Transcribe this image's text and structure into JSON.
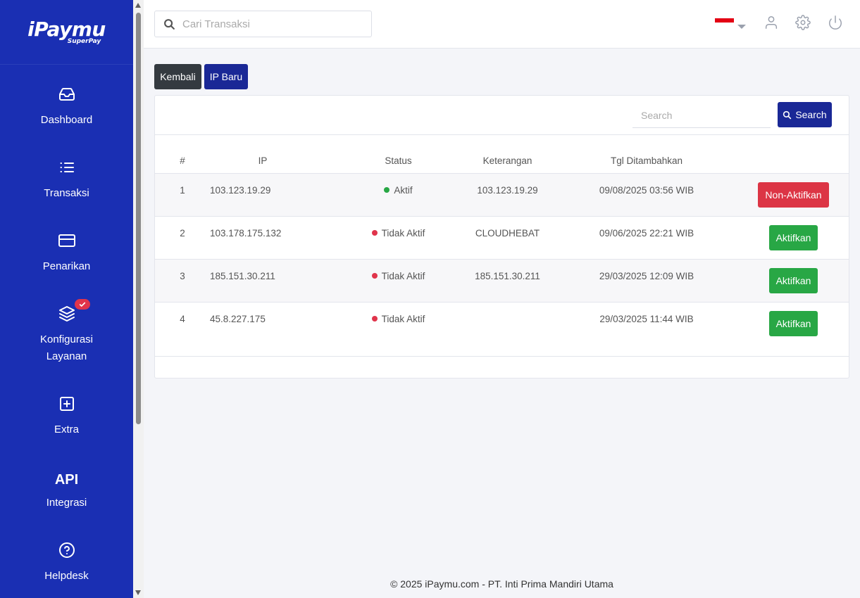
{
  "brand": {
    "name": "iPaymu",
    "sub": "SuperPay"
  },
  "sidebar": {
    "items": [
      {
        "label": "Dashboard",
        "icon": "inbox-icon"
      },
      {
        "label": "Transaksi",
        "icon": "list-icon"
      },
      {
        "label": "Penarikan",
        "icon": "credit-card-icon"
      },
      {
        "label": "Konfigurasi Layanan",
        "icon": "layers-icon",
        "badge": "check-icon"
      },
      {
        "label": "Extra",
        "icon": "plus-square-icon"
      },
      {
        "label": "Integrasi",
        "icon_text": "API"
      },
      {
        "label": "Helpdesk",
        "icon": "help-circle-icon"
      }
    ]
  },
  "header": {
    "search_placeholder": "Cari Transaksi",
    "language": "id",
    "icons": [
      "user-icon",
      "settings-icon",
      "power-icon"
    ]
  },
  "actions": {
    "back": "Kembali",
    "new_ip": "IP Baru"
  },
  "table": {
    "search_placeholder": "Search",
    "search_button": "Search",
    "columns": [
      "#",
      "IP",
      "Status",
      "Keterangan",
      "Tgl Ditambahkan",
      ""
    ],
    "rows": [
      {
        "num": "1",
        "ip": "103.123.19.29",
        "status": "Aktif",
        "status_color": "#28a745",
        "keterangan": "103.123.19.29",
        "tgl": "09/08/2025 03:56 WIB",
        "action": "Non-Aktifkan",
        "action_color": "#dc3545"
      },
      {
        "num": "2",
        "ip": "103.178.175.132",
        "status": "Tidak Aktif",
        "status_color": "#e0344b",
        "keterangan": "CLOUDHEBAT",
        "tgl": "09/06/2025 22:21 WIB",
        "action": "Aktifkan",
        "action_color": "#28a745"
      },
      {
        "num": "3",
        "ip": "185.151.30.211",
        "status": "Tidak Aktif",
        "status_color": "#e0344b",
        "keterangan": "185.151.30.211",
        "tgl": "29/03/2025 12:09 WIB",
        "action": "Aktifkan",
        "action_color": "#28a745"
      },
      {
        "num": "4",
        "ip": "45.8.227.175",
        "status": "Tidak Aktif",
        "status_color": "#e0344b",
        "keterangan": "",
        "tgl": "29/03/2025 11:44 WIB",
        "action": "Aktifkan",
        "action_color": "#28a745"
      }
    ]
  },
  "footer": {
    "text": "© 2025 iPaymu.com - PT. Inti Prima Mandiri Utama"
  },
  "colors": {
    "sidebar": "#1a2fb3",
    "primary_button": "#1a2896",
    "dark_button": "#343a40"
  }
}
